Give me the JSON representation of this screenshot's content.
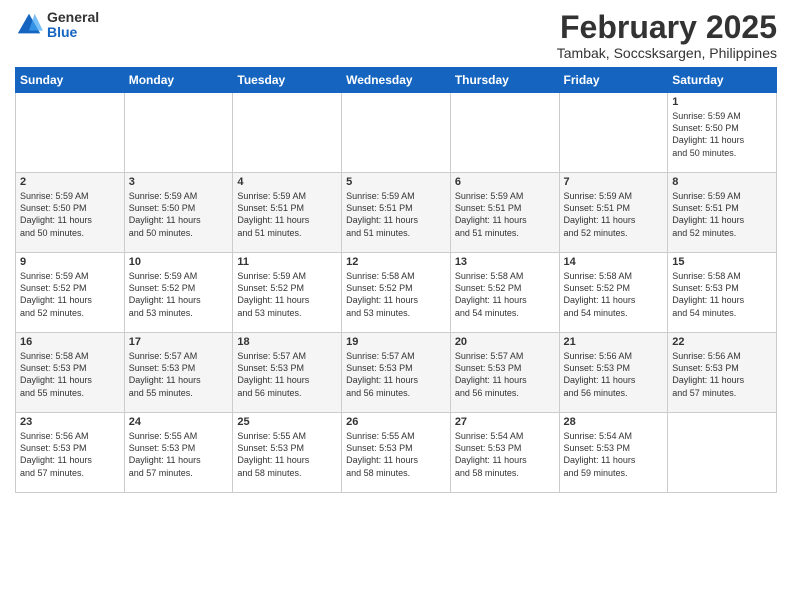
{
  "logo": {
    "general": "General",
    "blue": "Blue"
  },
  "title": "February 2025",
  "subtitle": "Tambak, Soccsksargen, Philippines",
  "days": [
    "Sunday",
    "Monday",
    "Tuesday",
    "Wednesday",
    "Thursday",
    "Friday",
    "Saturday"
  ],
  "weeks": [
    [
      {
        "day": "",
        "info": ""
      },
      {
        "day": "",
        "info": ""
      },
      {
        "day": "",
        "info": ""
      },
      {
        "day": "",
        "info": ""
      },
      {
        "day": "",
        "info": ""
      },
      {
        "day": "",
        "info": ""
      },
      {
        "day": "1",
        "info": "Sunrise: 5:59 AM\nSunset: 5:50 PM\nDaylight: 11 hours\nand 50 minutes."
      }
    ],
    [
      {
        "day": "2",
        "info": "Sunrise: 5:59 AM\nSunset: 5:50 PM\nDaylight: 11 hours\nand 50 minutes."
      },
      {
        "day": "3",
        "info": "Sunrise: 5:59 AM\nSunset: 5:50 PM\nDaylight: 11 hours\nand 50 minutes."
      },
      {
        "day": "4",
        "info": "Sunrise: 5:59 AM\nSunset: 5:51 PM\nDaylight: 11 hours\nand 51 minutes."
      },
      {
        "day": "5",
        "info": "Sunrise: 5:59 AM\nSunset: 5:51 PM\nDaylight: 11 hours\nand 51 minutes."
      },
      {
        "day": "6",
        "info": "Sunrise: 5:59 AM\nSunset: 5:51 PM\nDaylight: 11 hours\nand 51 minutes."
      },
      {
        "day": "7",
        "info": "Sunrise: 5:59 AM\nSunset: 5:51 PM\nDaylight: 11 hours\nand 52 minutes."
      },
      {
        "day": "8",
        "info": "Sunrise: 5:59 AM\nSunset: 5:51 PM\nDaylight: 11 hours\nand 52 minutes."
      }
    ],
    [
      {
        "day": "9",
        "info": "Sunrise: 5:59 AM\nSunset: 5:52 PM\nDaylight: 11 hours\nand 52 minutes."
      },
      {
        "day": "10",
        "info": "Sunrise: 5:59 AM\nSunset: 5:52 PM\nDaylight: 11 hours\nand 53 minutes."
      },
      {
        "day": "11",
        "info": "Sunrise: 5:59 AM\nSunset: 5:52 PM\nDaylight: 11 hours\nand 53 minutes."
      },
      {
        "day": "12",
        "info": "Sunrise: 5:58 AM\nSunset: 5:52 PM\nDaylight: 11 hours\nand 53 minutes."
      },
      {
        "day": "13",
        "info": "Sunrise: 5:58 AM\nSunset: 5:52 PM\nDaylight: 11 hours\nand 54 minutes."
      },
      {
        "day": "14",
        "info": "Sunrise: 5:58 AM\nSunset: 5:52 PM\nDaylight: 11 hours\nand 54 minutes."
      },
      {
        "day": "15",
        "info": "Sunrise: 5:58 AM\nSunset: 5:53 PM\nDaylight: 11 hours\nand 54 minutes."
      }
    ],
    [
      {
        "day": "16",
        "info": "Sunrise: 5:58 AM\nSunset: 5:53 PM\nDaylight: 11 hours\nand 55 minutes."
      },
      {
        "day": "17",
        "info": "Sunrise: 5:57 AM\nSunset: 5:53 PM\nDaylight: 11 hours\nand 55 minutes."
      },
      {
        "day": "18",
        "info": "Sunrise: 5:57 AM\nSunset: 5:53 PM\nDaylight: 11 hours\nand 56 minutes."
      },
      {
        "day": "19",
        "info": "Sunrise: 5:57 AM\nSunset: 5:53 PM\nDaylight: 11 hours\nand 56 minutes."
      },
      {
        "day": "20",
        "info": "Sunrise: 5:57 AM\nSunset: 5:53 PM\nDaylight: 11 hours\nand 56 minutes."
      },
      {
        "day": "21",
        "info": "Sunrise: 5:56 AM\nSunset: 5:53 PM\nDaylight: 11 hours\nand 56 minutes."
      },
      {
        "day": "22",
        "info": "Sunrise: 5:56 AM\nSunset: 5:53 PM\nDaylight: 11 hours\nand 57 minutes."
      }
    ],
    [
      {
        "day": "23",
        "info": "Sunrise: 5:56 AM\nSunset: 5:53 PM\nDaylight: 11 hours\nand 57 minutes."
      },
      {
        "day": "24",
        "info": "Sunrise: 5:55 AM\nSunset: 5:53 PM\nDaylight: 11 hours\nand 57 minutes."
      },
      {
        "day": "25",
        "info": "Sunrise: 5:55 AM\nSunset: 5:53 PM\nDaylight: 11 hours\nand 58 minutes."
      },
      {
        "day": "26",
        "info": "Sunrise: 5:55 AM\nSunset: 5:53 PM\nDaylight: 11 hours\nand 58 minutes."
      },
      {
        "day": "27",
        "info": "Sunrise: 5:54 AM\nSunset: 5:53 PM\nDaylight: 11 hours\nand 58 minutes."
      },
      {
        "day": "28",
        "info": "Sunrise: 5:54 AM\nSunset: 5:53 PM\nDaylight: 11 hours\nand 59 minutes."
      },
      {
        "day": "",
        "info": ""
      }
    ]
  ]
}
